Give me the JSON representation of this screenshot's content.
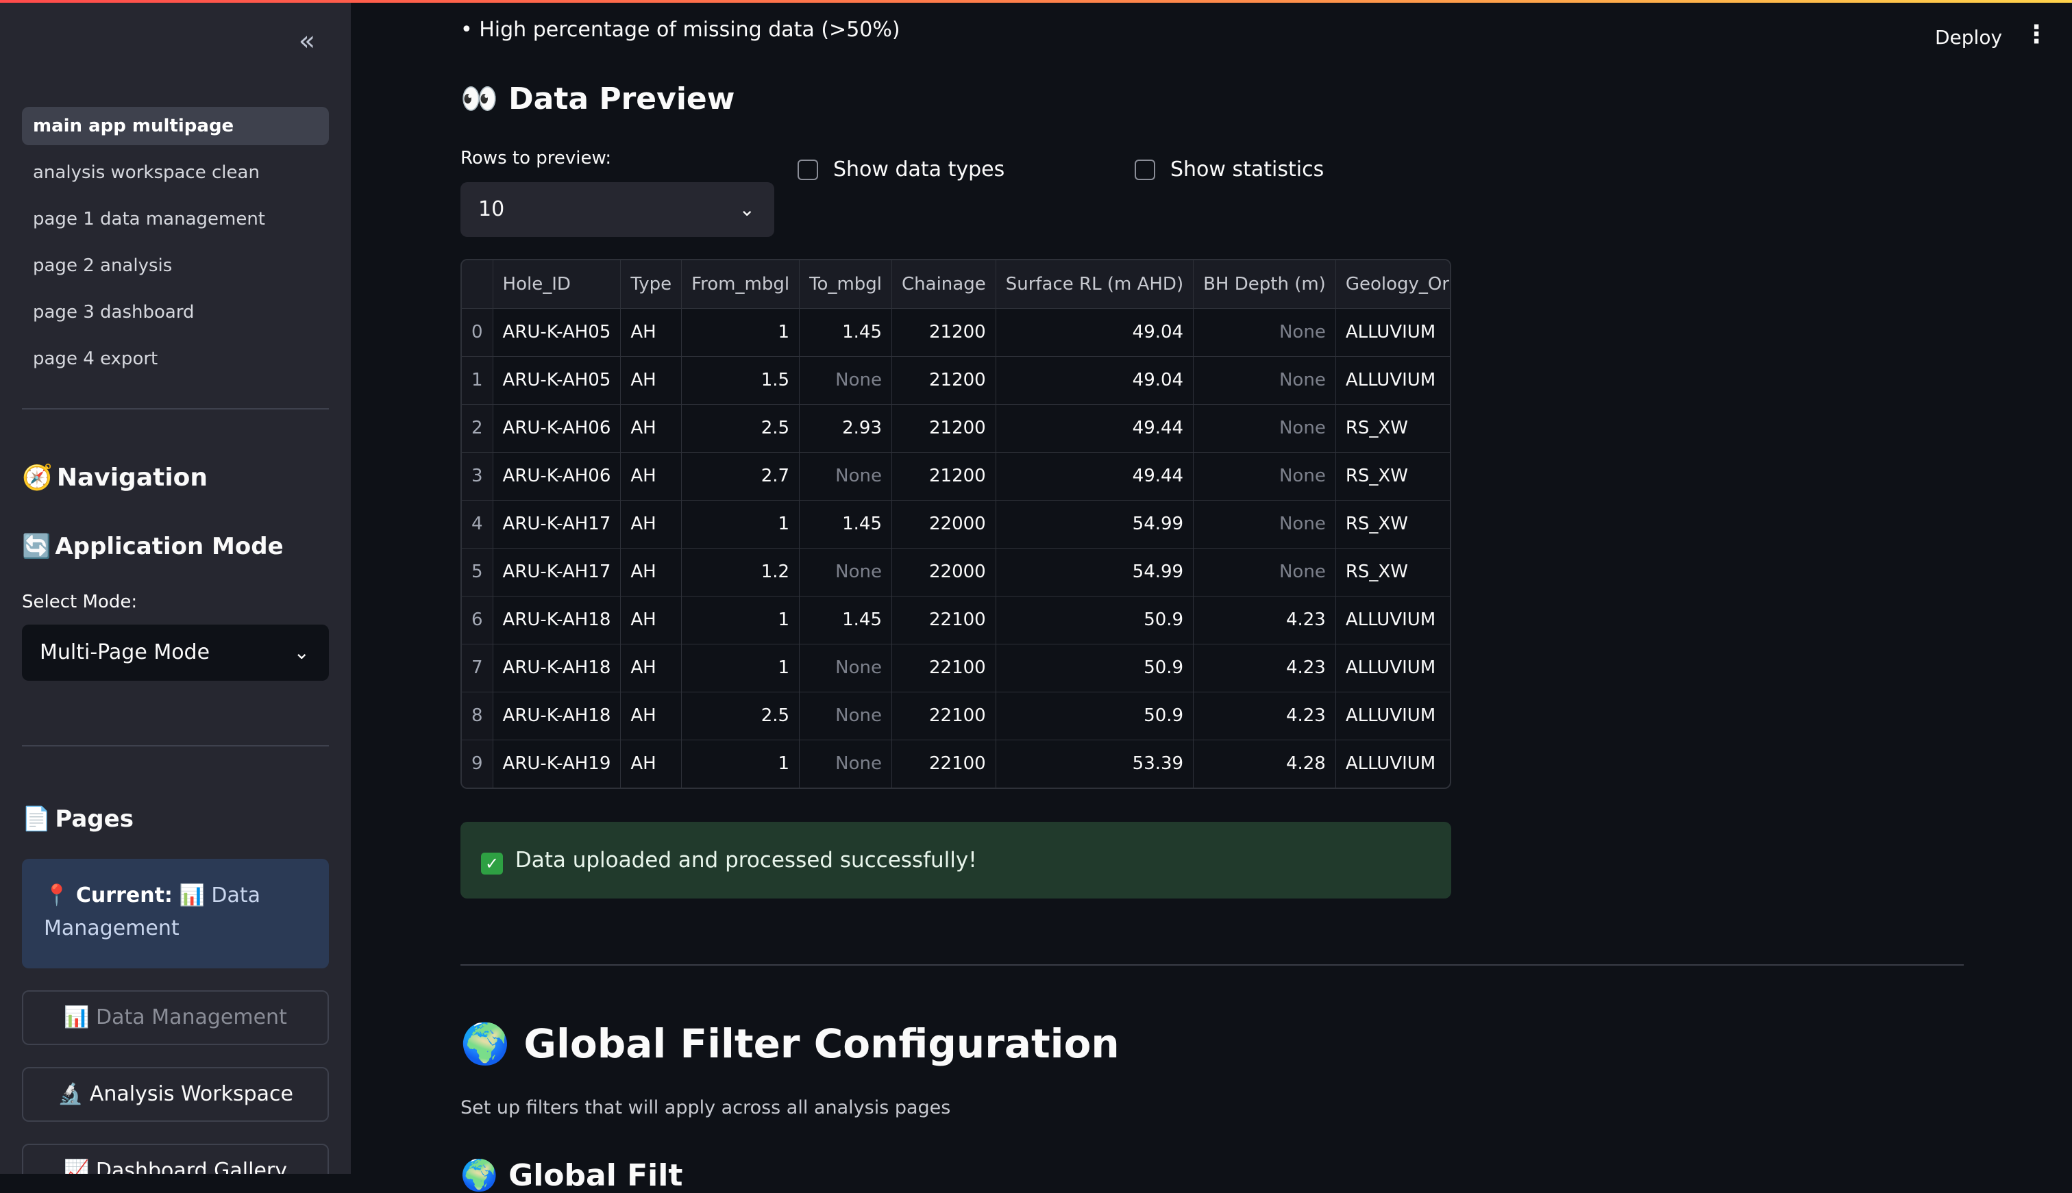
{
  "sidebar": {
    "nav_items": [
      {
        "label": "main app multipage",
        "active": true
      },
      {
        "label": "analysis workspace clean",
        "active": false
      },
      {
        "label": "page 1 data management",
        "active": false
      },
      {
        "label": "page 2 analysis",
        "active": false
      },
      {
        "label": "page 3 dashboard",
        "active": false
      },
      {
        "label": "page 4 export",
        "active": false
      }
    ],
    "navigation_heading": "Navigation",
    "navigation_icon": "🧭",
    "app_mode_heading": "Application Mode",
    "app_mode_icon": "🔄",
    "select_mode_label": "Select Mode:",
    "select_mode_value": "Multi-Page Mode",
    "pages_heading": "Pages",
    "pages_icon": "📄",
    "current_prefix": "📍",
    "current_label": "Current:",
    "current_value": "📊 Data Management",
    "buttons": {
      "data_management": "📊 Data Management",
      "analysis_workspace": "🔬 Analysis Workspace",
      "dashboard_gallery": "📈 Dashboard Gallery"
    }
  },
  "header": {
    "deploy_label": "Deploy",
    "menu_icon": "⋮"
  },
  "main": {
    "bullet_text": "• High percentage of missing data (>50%)",
    "data_preview_heading": "👀 Data Preview",
    "rows_label": "Rows to preview:",
    "rows_value": "10",
    "show_data_types": "Show data types",
    "show_statistics": "Show statistics",
    "table": {
      "columns": [
        "",
        "Hole_ID",
        "Type",
        "From_mbgl",
        "To_mbgl",
        "Chainage",
        "Surface RL (m AHD)",
        "BH Depth (m)",
        "Geology_Org"
      ],
      "rows": [
        [
          "0",
          "ARU-K-AH05",
          "AH",
          "1",
          "1.45",
          "21200",
          "49.04",
          "None",
          "ALLUVIUM"
        ],
        [
          "1",
          "ARU-K-AH05",
          "AH",
          "1.5",
          "None",
          "21200",
          "49.04",
          "None",
          "ALLUVIUM"
        ],
        [
          "2",
          "ARU-K-AH06",
          "AH",
          "2.5",
          "2.93",
          "21200",
          "49.44",
          "None",
          "RS_XW"
        ],
        [
          "3",
          "ARU-K-AH06",
          "AH",
          "2.7",
          "None",
          "21200",
          "49.44",
          "None",
          "RS_XW"
        ],
        [
          "4",
          "ARU-K-AH17",
          "AH",
          "1",
          "1.45",
          "22000",
          "54.99",
          "None",
          "RS_XW"
        ],
        [
          "5",
          "ARU-K-AH17",
          "AH",
          "1.2",
          "None",
          "22000",
          "54.99",
          "None",
          "RS_XW"
        ],
        [
          "6",
          "ARU-K-AH18",
          "AH",
          "1",
          "1.45",
          "22100",
          "50.9",
          "4.23",
          "ALLUVIUM"
        ],
        [
          "7",
          "ARU-K-AH18",
          "AH",
          "1",
          "None",
          "22100",
          "50.9",
          "4.23",
          "ALLUVIUM"
        ],
        [
          "8",
          "ARU-K-AH18",
          "AH",
          "2.5",
          "None",
          "22100",
          "50.9",
          "4.23",
          "ALLUVIUM"
        ],
        [
          "9",
          "ARU-K-AH19",
          "AH",
          "1",
          "None",
          "22100",
          "53.39",
          "4.28",
          "ALLUVIUM"
        ]
      ]
    },
    "success_message": "Data uploaded and processed successfully!",
    "global_filter_heading": "🌍 Global Filter Configuration",
    "global_filter_subtitle": "Set up filters that will apply across all analysis pages",
    "next_heading_partial": "🌍 Global Filt"
  }
}
